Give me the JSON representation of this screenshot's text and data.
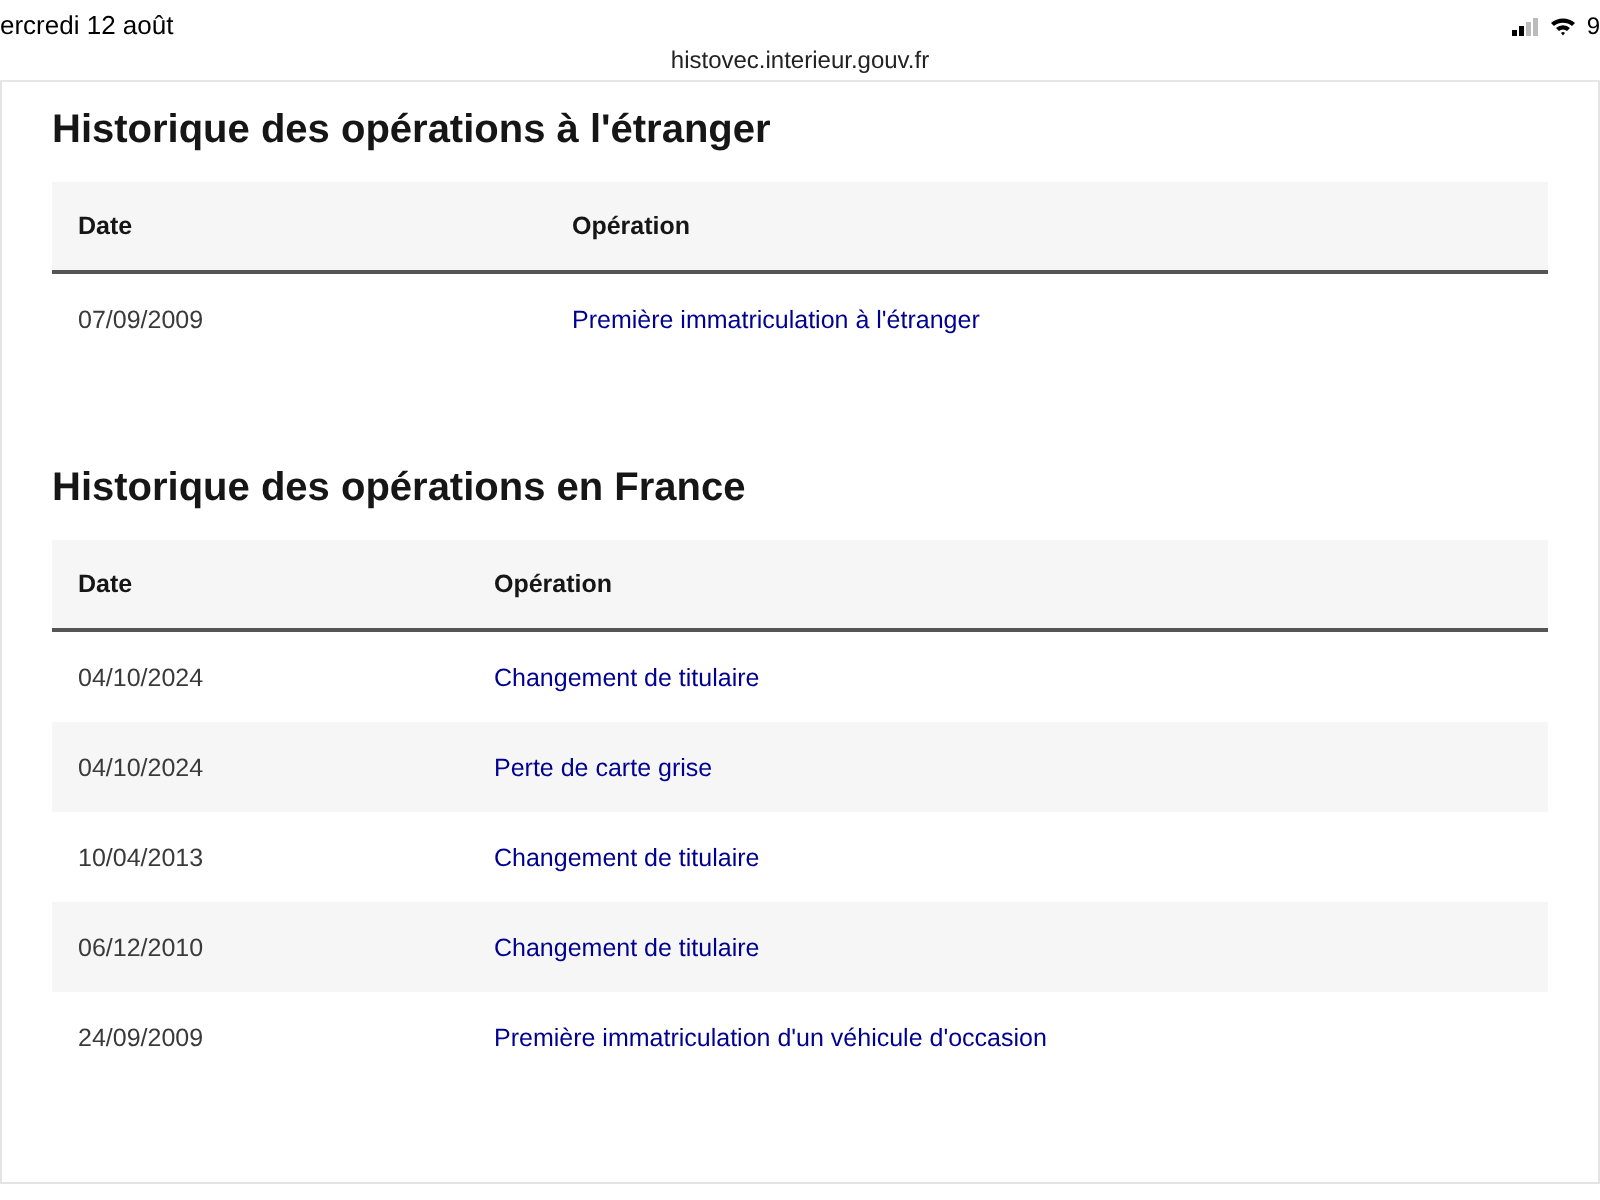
{
  "status_bar": {
    "date": "ercredi 12 août",
    "url": "histovec.interieur.gouv.fr",
    "battery": "9"
  },
  "sections": [
    {
      "title": "Historique des opérations à l'étranger",
      "columns": [
        "Date",
        "Opération"
      ],
      "rows": [
        {
          "date": "07/09/2009",
          "operation": "Première immatriculation à l'étranger"
        }
      ]
    },
    {
      "title": "Historique des opérations en France",
      "columns": [
        "Date",
        "Opération"
      ],
      "rows": [
        {
          "date": "04/10/2024",
          "operation": "Changement de titulaire"
        },
        {
          "date": "04/10/2024",
          "operation": "Perte de carte grise"
        },
        {
          "date": "10/04/2013",
          "operation": "Changement de titulaire"
        },
        {
          "date": "06/12/2010",
          "operation": "Changement de titulaire"
        },
        {
          "date": "24/09/2009",
          "operation": "Première immatriculation d'un véhicule d'occasion"
        }
      ]
    }
  ]
}
